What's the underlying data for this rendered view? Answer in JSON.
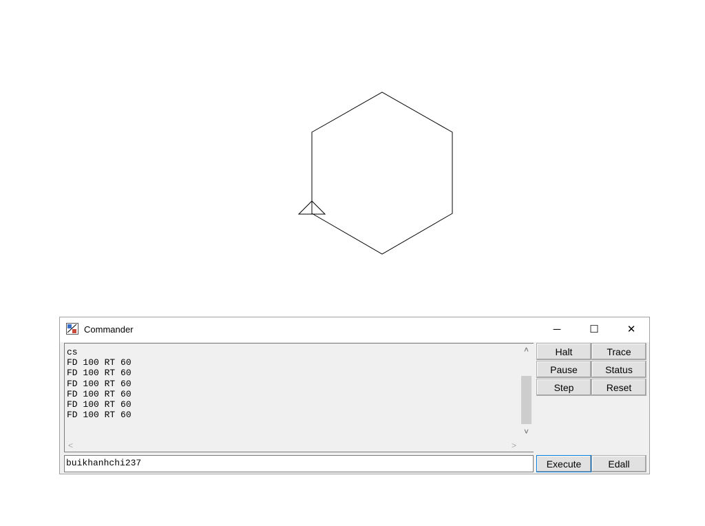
{
  "window": {
    "title": "Commander",
    "minimize_glyph": "─",
    "maximize_glyph": "☐",
    "close_glyph": "✕"
  },
  "history": {
    "lines": [
      "cs",
      "FD 100 RT 60",
      "FD 100 RT 60",
      "FD 100 RT 60",
      "FD 100 RT 60",
      "FD 100 RT 60",
      "FD 100 RT 60"
    ]
  },
  "input": {
    "value": "buikhanhchi237"
  },
  "buttons": {
    "halt": "Halt",
    "trace": "Trace",
    "pause": "Pause",
    "status": "Status",
    "step": "Step",
    "reset": "Reset",
    "execute": "Execute",
    "edall": "Edall"
  },
  "scroll": {
    "up": "˄",
    "down": "˅",
    "left": "<",
    "right": ">"
  },
  "drawing": {
    "stroke_color": "#000000",
    "turtle_icon": "turtle-icon",
    "shape_icon": "hexagon"
  }
}
